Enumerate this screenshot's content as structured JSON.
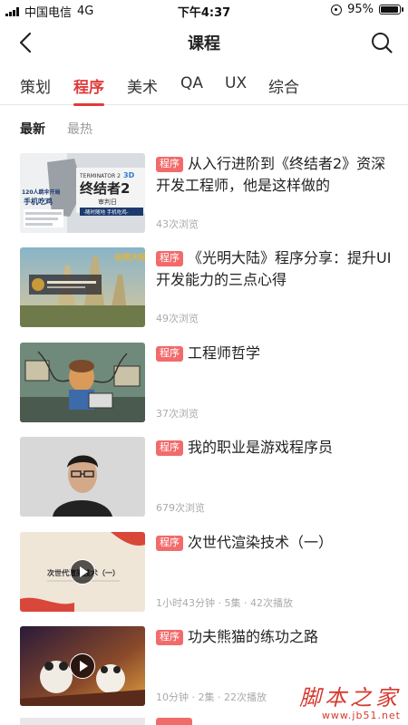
{
  "status_bar": {
    "carrier": "中国电信",
    "network": "4G",
    "time": "下午4:37",
    "battery_percent": "95%",
    "battery_level": 0.95
  },
  "nav": {
    "title": "课程",
    "back_icon": "chevron-left-icon",
    "search_icon": "search-icon"
  },
  "category_tabs": [
    {
      "label": "策划",
      "active": false
    },
    {
      "label": "程序",
      "active": true
    },
    {
      "label": "美术",
      "active": false
    },
    {
      "label": "QA",
      "active": false
    },
    {
      "label": "UX",
      "active": false
    },
    {
      "label": "综合",
      "active": false
    }
  ],
  "sort_tabs": [
    {
      "label": "最新",
      "active": true
    },
    {
      "label": "最热",
      "active": false
    }
  ],
  "articles": [
    {
      "badge": "程序",
      "title": "从入行进阶到《终结者2》资深开发工程师，他是这样做的",
      "meta": "43次浏览",
      "video": false
    },
    {
      "badge": "程序",
      "title": "《光明大陆》程序分享：提升UI开发能力的三点心得",
      "meta": "49次浏览",
      "video": false
    },
    {
      "badge": "程序",
      "title": "工程师哲学",
      "meta": "37次浏览",
      "video": false
    },
    {
      "badge": "程序",
      "title": "我的职业是游戏程序员",
      "meta": "679次浏览",
      "video": false
    },
    {
      "badge": "程序",
      "title": "次世代渲染技术（一）",
      "meta": "1小时43分钟 · 5集 · 42次播放",
      "video": true
    },
    {
      "badge": "程序",
      "title": "功夫熊猫的练功之路",
      "meta": "10分钟 · 2集 · 22次播放",
      "video": true
    }
  ],
  "thumbnails": {
    "t1": {
      "t_en": "TERMINATOR 2",
      "t_3d": "3D",
      "t_cn": "终结者2",
      "t_sub": "审判日",
      "t_tag": "-随时随地 手机吃鸡-",
      "t_left1": "120人跳伞开局",
      "t_left2": "手机吃鸡"
    },
    "t2": {
      "t_logo": "光明大陆"
    },
    "t5": {
      "t_text": "次世代渲染技术（一）"
    }
  },
  "watermark": {
    "cn": "脚本之家",
    "url": "www.jb51.net"
  },
  "colors": {
    "accent": "#e03b3b",
    "badge": "#f26b6b",
    "meta": "#aaaaaa"
  }
}
